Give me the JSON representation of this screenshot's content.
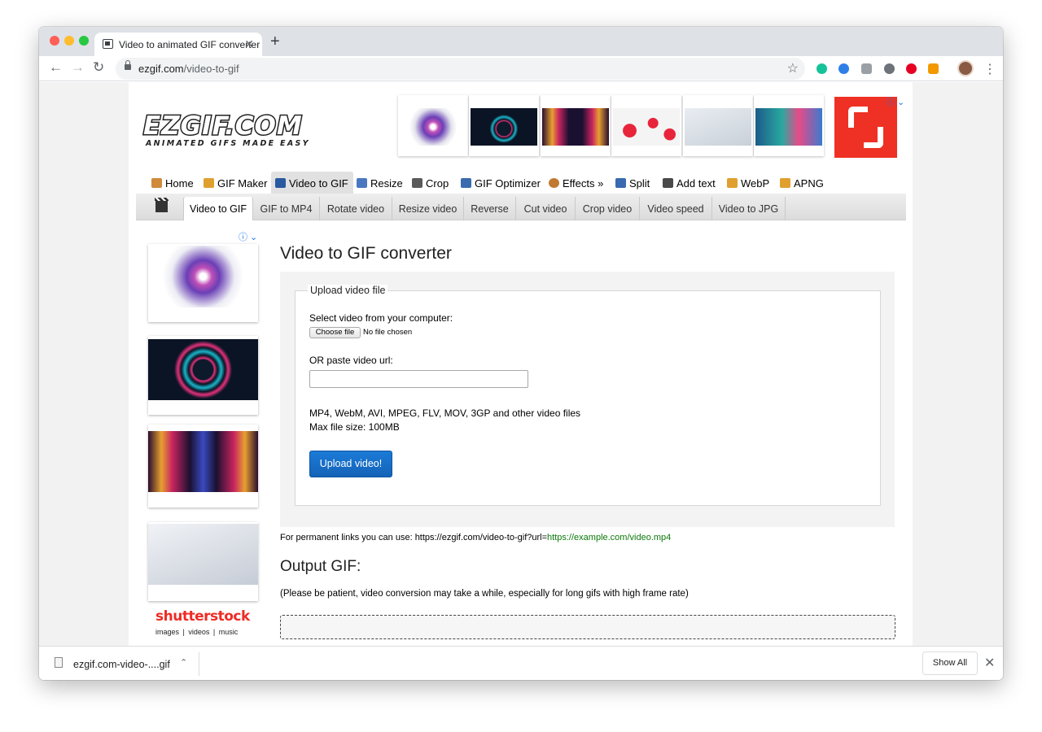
{
  "browser": {
    "tab_title": "Video to animated GIF converter",
    "tab_close": "✕",
    "new_tab": "+",
    "nav_back": "←",
    "nav_forward": "→",
    "nav_reload": "↻",
    "url_host": "ezgif.com",
    "url_path": "/video-to-gif",
    "bookmark": "☆",
    "menu": "⋮"
  },
  "site": {
    "logo_title": "EZGIF.COM",
    "logo_tagline": "ANIMATED GIFS MADE EASY",
    "ad_info": "ⓘ ⌄"
  },
  "main_menu": [
    {
      "label": "Home",
      "icon": "home-icon"
    },
    {
      "label": "GIF Maker",
      "icon": "gif-maker-icon"
    },
    {
      "label": "Video to GIF",
      "icon": "film-icon"
    },
    {
      "label": "Resize",
      "icon": "resize-icon"
    },
    {
      "label": "Crop",
      "icon": "crop-icon"
    },
    {
      "label": "GIF Optimizer",
      "icon": "optimizer-icon"
    },
    {
      "label": "Effects »",
      "icon": "effects-icon"
    },
    {
      "label": "Split",
      "icon": "split-icon"
    },
    {
      "label": "Add text",
      "icon": "text-icon"
    },
    {
      "label": "WebP",
      "icon": "webp-icon"
    },
    {
      "label": "APNG",
      "icon": "apng-icon"
    }
  ],
  "sub_menu": [
    "Video to GIF",
    "GIF to MP4",
    "Rotate video",
    "Resize video",
    "Reverse",
    "Cut video",
    "Crop video",
    "Video speed",
    "Video to JPG"
  ],
  "sidebar_ad": {
    "brand": "shutterstock",
    "tagline": "images  |  videos  |  music"
  },
  "content": {
    "title": "Video to GIF converter",
    "fieldset_legend": "Upload video file",
    "select_label": "Select video from your computer:",
    "choose_button": "Choose file",
    "no_file": "No file chosen",
    "url_label": "OR paste video url:",
    "url_value": "",
    "formats": "MP4, WebM, AVI, MPEG, FLV, MOV, 3GP and other video files",
    "max_size": "Max file size: 100MB",
    "upload_button": "Upload video!",
    "permalink_prefix": "For permanent links you can use: https://ezgif.com/video-to-gif?url=",
    "permalink_example": "https://example.com/video.mp4",
    "output_title": "Output GIF:",
    "patience_note": "(Please be patient, video conversion may take a while, especially for long gifs with high frame rate)"
  },
  "downloads": {
    "file_name": "ezgif.com-video-....gif",
    "caret": "⌃",
    "show_all": "Show All",
    "close": "✕"
  }
}
